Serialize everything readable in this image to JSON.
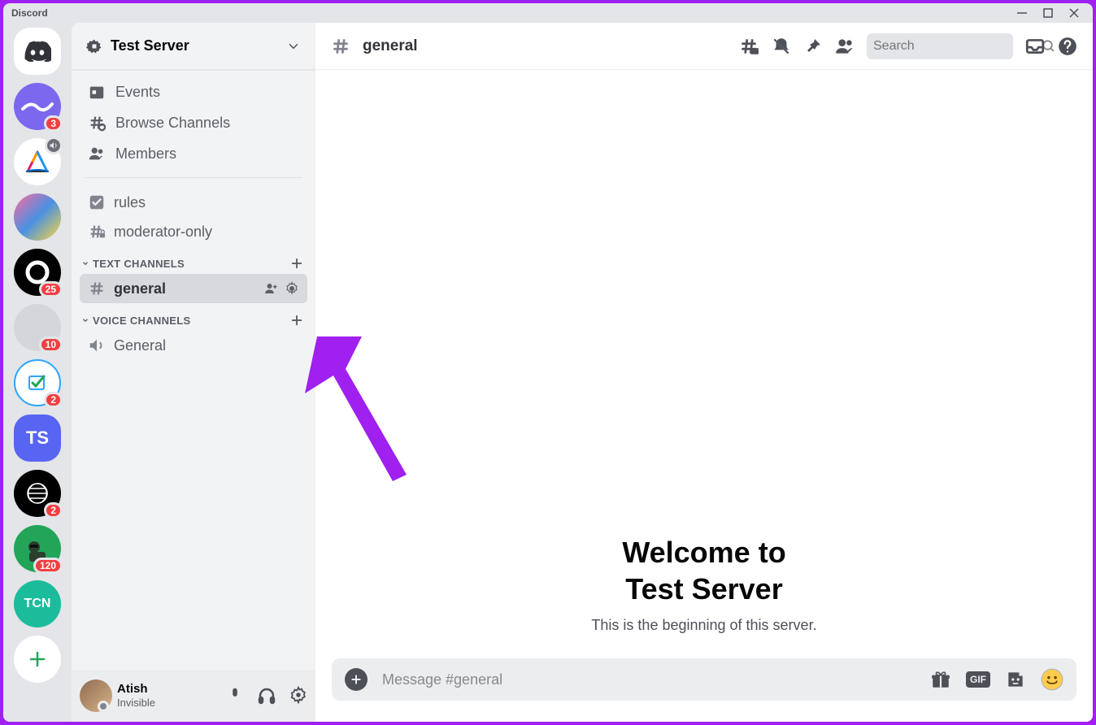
{
  "titlebar": {
    "app_name": "Discord"
  },
  "rail": {
    "servers": [
      {
        "id": "home",
        "type": "logo",
        "badge": null
      },
      {
        "id": "s1",
        "color": "#7b68ee",
        "badge": "3"
      },
      {
        "id": "s2",
        "color": "#ffffff",
        "badge": null,
        "audio": true
      },
      {
        "id": "s3",
        "color": "#ffffff",
        "badge": null
      },
      {
        "id": "s4",
        "color": "#000000",
        "badge": "25"
      },
      {
        "id": "s5",
        "color": "#d4d6d9",
        "badge": "10"
      },
      {
        "id": "s6",
        "color": "#2aa6ff",
        "badge": "2"
      },
      {
        "id": "s7",
        "color": "#5865f2",
        "badge": null,
        "label": "TS"
      },
      {
        "id": "s8",
        "color": "#000000",
        "badge": "2"
      },
      {
        "id": "s9",
        "color": "#23a559",
        "badge": "120"
      },
      {
        "id": "s10",
        "color": "#1abc9c",
        "badge": null
      }
    ]
  },
  "sidebar": {
    "server_name": "Test Server",
    "links": {
      "events": "Events",
      "browse": "Browse Channels",
      "members": "Members"
    },
    "pinned": [
      {
        "name": "rules",
        "icon": "rules"
      },
      {
        "name": "moderator-only",
        "icon": "hash-lock"
      }
    ],
    "categories": [
      {
        "name": "TEXT CHANNELS",
        "channels": [
          {
            "name": "general",
            "active": true
          }
        ]
      },
      {
        "name": "VOICE CHANNELS",
        "channels": [
          {
            "name": "General",
            "voice": true
          }
        ]
      }
    ]
  },
  "user": {
    "name": "Atish",
    "status": "Invisible"
  },
  "topbar": {
    "channel": "general",
    "search_placeholder": "Search"
  },
  "welcome": {
    "line1": "Welcome to",
    "line2": "Test Server",
    "sub": "This is the beginning of this server."
  },
  "composer": {
    "placeholder": "Message #general"
  }
}
